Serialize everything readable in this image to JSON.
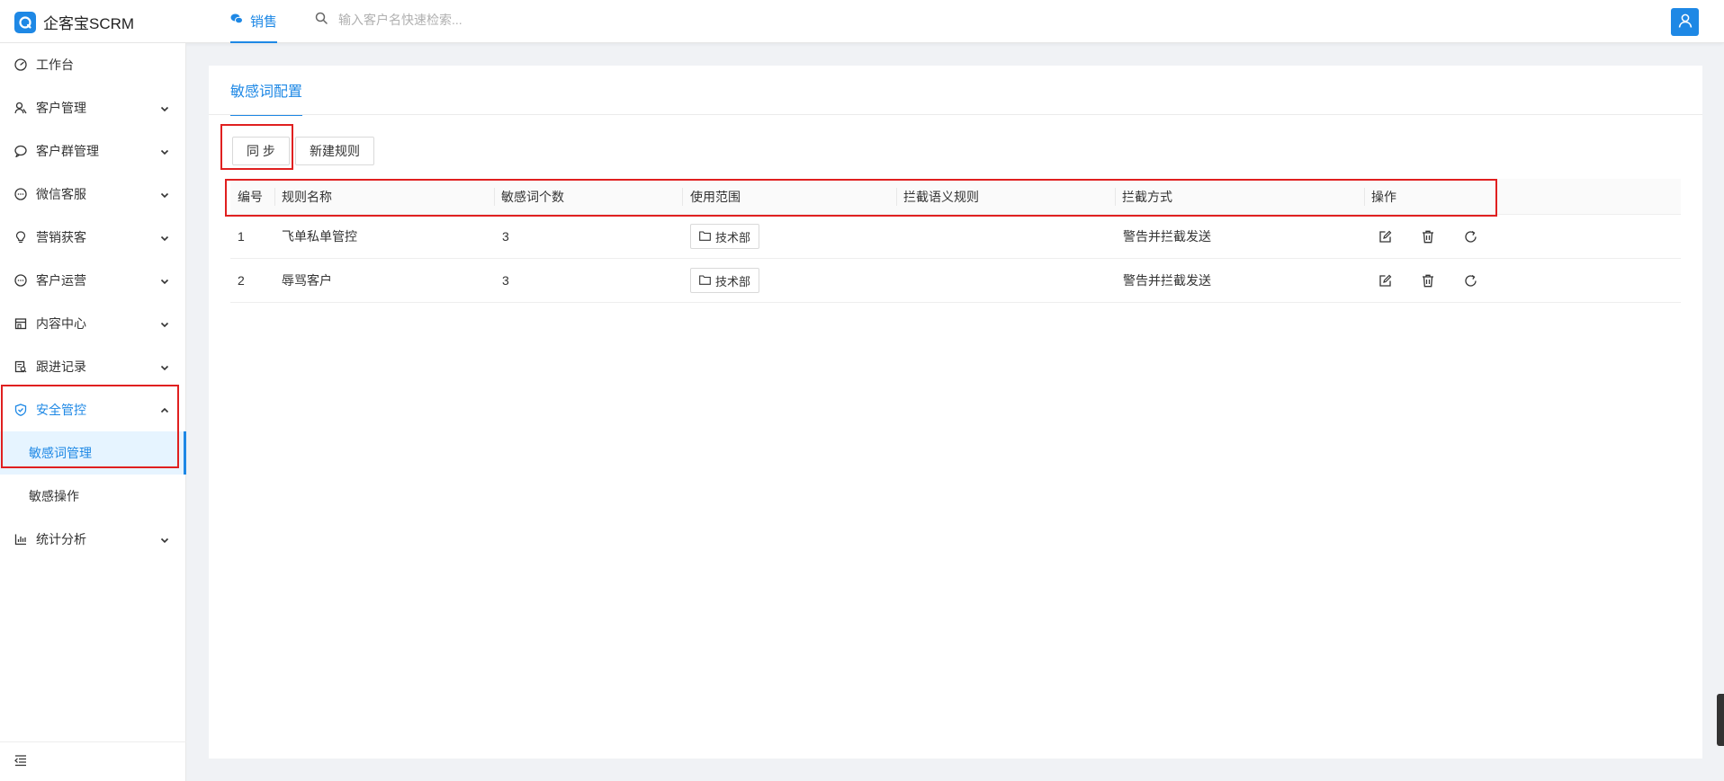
{
  "app": {
    "title": "企客宝SCRM"
  },
  "header": {
    "nav_tab_label": "销售",
    "search_placeholder": "输入客户名快速检索..."
  },
  "sidebar": {
    "items": [
      {
        "label": "工作台",
        "icon": "dashboard-icon"
      },
      {
        "label": "客户管理",
        "icon": "users-icon"
      },
      {
        "label": "客户群管理",
        "icon": "chat-icon"
      },
      {
        "label": "微信客服",
        "icon": "message-icon"
      },
      {
        "label": "营销获客",
        "icon": "bulb-icon"
      },
      {
        "label": "客户运营",
        "icon": "message-icon"
      },
      {
        "label": "内容中心",
        "icon": "store-icon"
      },
      {
        "label": "跟进记录",
        "icon": "record-icon"
      },
      {
        "label": "安全管控",
        "icon": "shield-icon"
      },
      {
        "label": "统计分析",
        "icon": "chart-icon"
      }
    ],
    "sub_items": [
      {
        "label": "敏感词管理"
      },
      {
        "label": "敏感操作"
      }
    ]
  },
  "page": {
    "tab_label": "敏感词配置",
    "sync_button": "同 步",
    "new_rule_button": "新建规则"
  },
  "table": {
    "columns": [
      "编号",
      "规则名称",
      "敏感词个数",
      "使用范围",
      "拦截语义规则",
      "拦截方式",
      "操作"
    ],
    "rows": [
      {
        "id": "1",
        "name": "飞单私单管控",
        "count": "3",
        "scope": "技术部",
        "semantic": "",
        "method": "警告并拦截发送"
      },
      {
        "id": "2",
        "name": "辱骂客户",
        "count": "3",
        "scope": "技术部",
        "semantic": "",
        "method": "警告并拦截发送"
      }
    ]
  },
  "colors": {
    "accent": "#1e88e5",
    "highlight": "#e02020",
    "active_bg": "#e6f4ff"
  }
}
